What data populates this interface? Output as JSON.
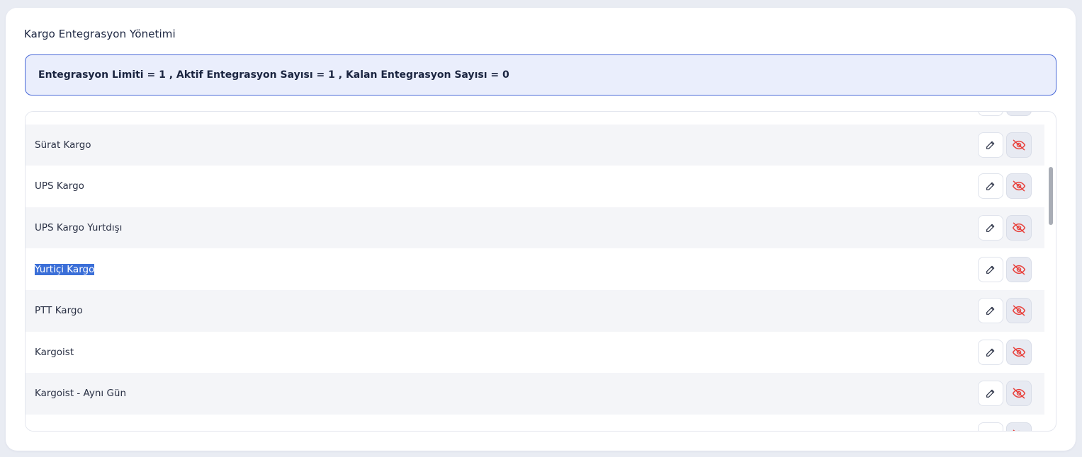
{
  "header": {
    "title": "Kargo Entegrasyon Yönetimi"
  },
  "info": {
    "text": "Entegrasyon Limiti = 1 , Aktif Entegrasyon Sayısı = 1 , Kalan Entegrasyon Sayısı = 0"
  },
  "list": {
    "items": [
      {
        "label": ""
      },
      {
        "label": "Sürat Kargo"
      },
      {
        "label": "UPS Kargo"
      },
      {
        "label": "UPS Kargo Yurtdışı"
      },
      {
        "label": "Yurtiçi Kargo",
        "selected": true
      },
      {
        "label": "PTT Kargo"
      },
      {
        "label": "Kargoist"
      },
      {
        "label": "Kargoist - Aynı Gün"
      },
      {
        "label": ""
      }
    ],
    "edit_icon": "pencil-icon",
    "hide_icon": "eye-off-icon"
  },
  "colors": {
    "accent": "#4a6ad8",
    "info_bg": "#eaeefc",
    "hide_icon": "#e8413c",
    "selection": "#3b6fd8"
  }
}
